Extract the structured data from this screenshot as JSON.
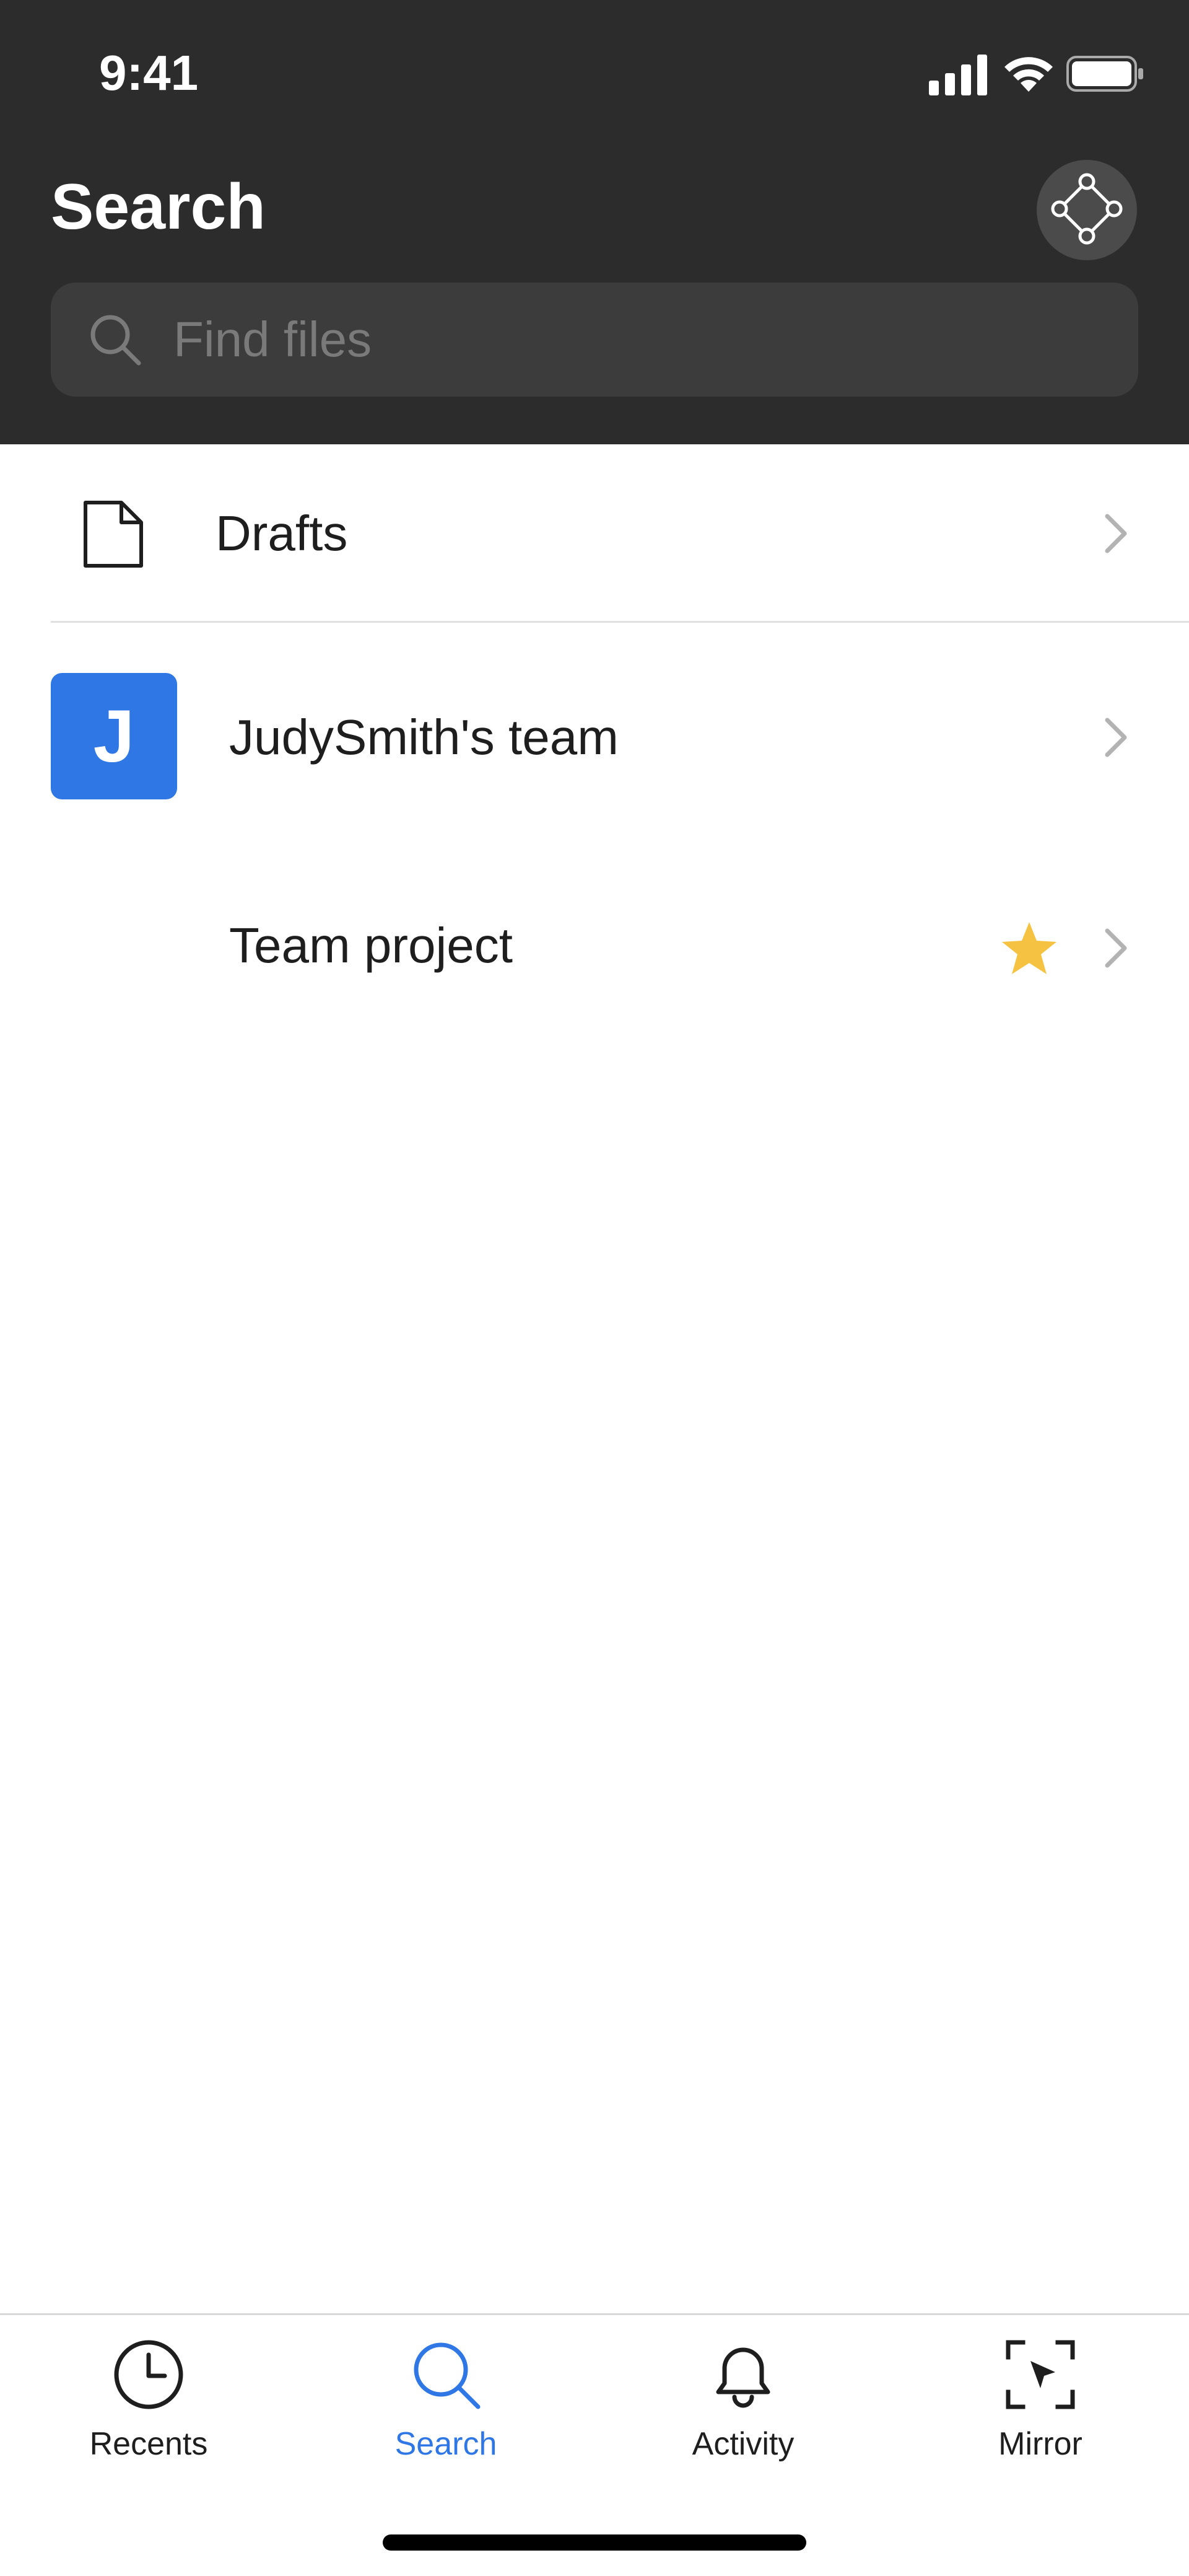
{
  "status_bar": {
    "time": "9:41"
  },
  "header": {
    "title": "Search",
    "plugin_icon": "component-diamond-icon"
  },
  "search": {
    "placeholder": "Find files",
    "value": ""
  },
  "list": {
    "drafts": {
      "label": "Drafts",
      "icon": "document-icon"
    },
    "team": {
      "label": "JudySmith's team",
      "avatar_initial": "J",
      "avatar_color": "#2f77e5"
    },
    "project": {
      "label": "Team project",
      "starred": true,
      "star_color": "#f5c242"
    }
  },
  "tabbar": {
    "tabs": [
      {
        "label": "Recents",
        "icon": "clock-icon",
        "active": false
      },
      {
        "label": "Search",
        "icon": "search-icon",
        "active": true
      },
      {
        "label": "Activity",
        "icon": "bell-icon",
        "active": false
      },
      {
        "label": "Mirror",
        "icon": "mirror-icon",
        "active": false
      }
    ],
    "active_color": "#2f77e5"
  },
  "colors": {
    "header_bg": "#2c2c2c",
    "search_bg": "#3c3c3c"
  }
}
